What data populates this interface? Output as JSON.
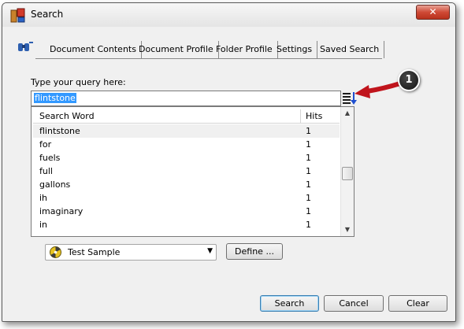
{
  "window": {
    "title": "Search",
    "close_label": "✕"
  },
  "tabs": [
    {
      "label": "Document Contents",
      "active": true
    },
    {
      "label": "Document Profile",
      "active": false
    },
    {
      "label": "Folder Profile",
      "active": false
    },
    {
      "label": "Settings",
      "active": false
    },
    {
      "label": "Saved Search",
      "active": false
    }
  ],
  "query": {
    "label": "Type your query here:",
    "value": "flintstone"
  },
  "word_list": {
    "columns": {
      "word": "Search Word",
      "hits": "Hits"
    },
    "rows": [
      {
        "word": "flintstone",
        "hits": "1",
        "selected": true
      },
      {
        "word": "for",
        "hits": "1"
      },
      {
        "word": "fuels",
        "hits": "1"
      },
      {
        "word": "full",
        "hits": "1"
      },
      {
        "word": "gallons",
        "hits": "1"
      },
      {
        "word": "ih",
        "hits": "1"
      },
      {
        "word": "imaginary",
        "hits": "1"
      },
      {
        "word": "in",
        "hits": "1"
      }
    ]
  },
  "profile": {
    "selected": "Test Sample",
    "define_label": "Define ..."
  },
  "buttons": {
    "search": "Search",
    "cancel": "Cancel",
    "clear": "Clear"
  },
  "callout": {
    "number": "1"
  },
  "icons": {
    "app": "app-icon",
    "search_logo": "binoculars-icon",
    "sort": "sort-icon",
    "profile": "profile-icon"
  },
  "colors": {
    "selection": "#3399ff",
    "close": "#cf4a36",
    "callout_arrow": "#c0141c",
    "callout_badge": "#111111"
  }
}
